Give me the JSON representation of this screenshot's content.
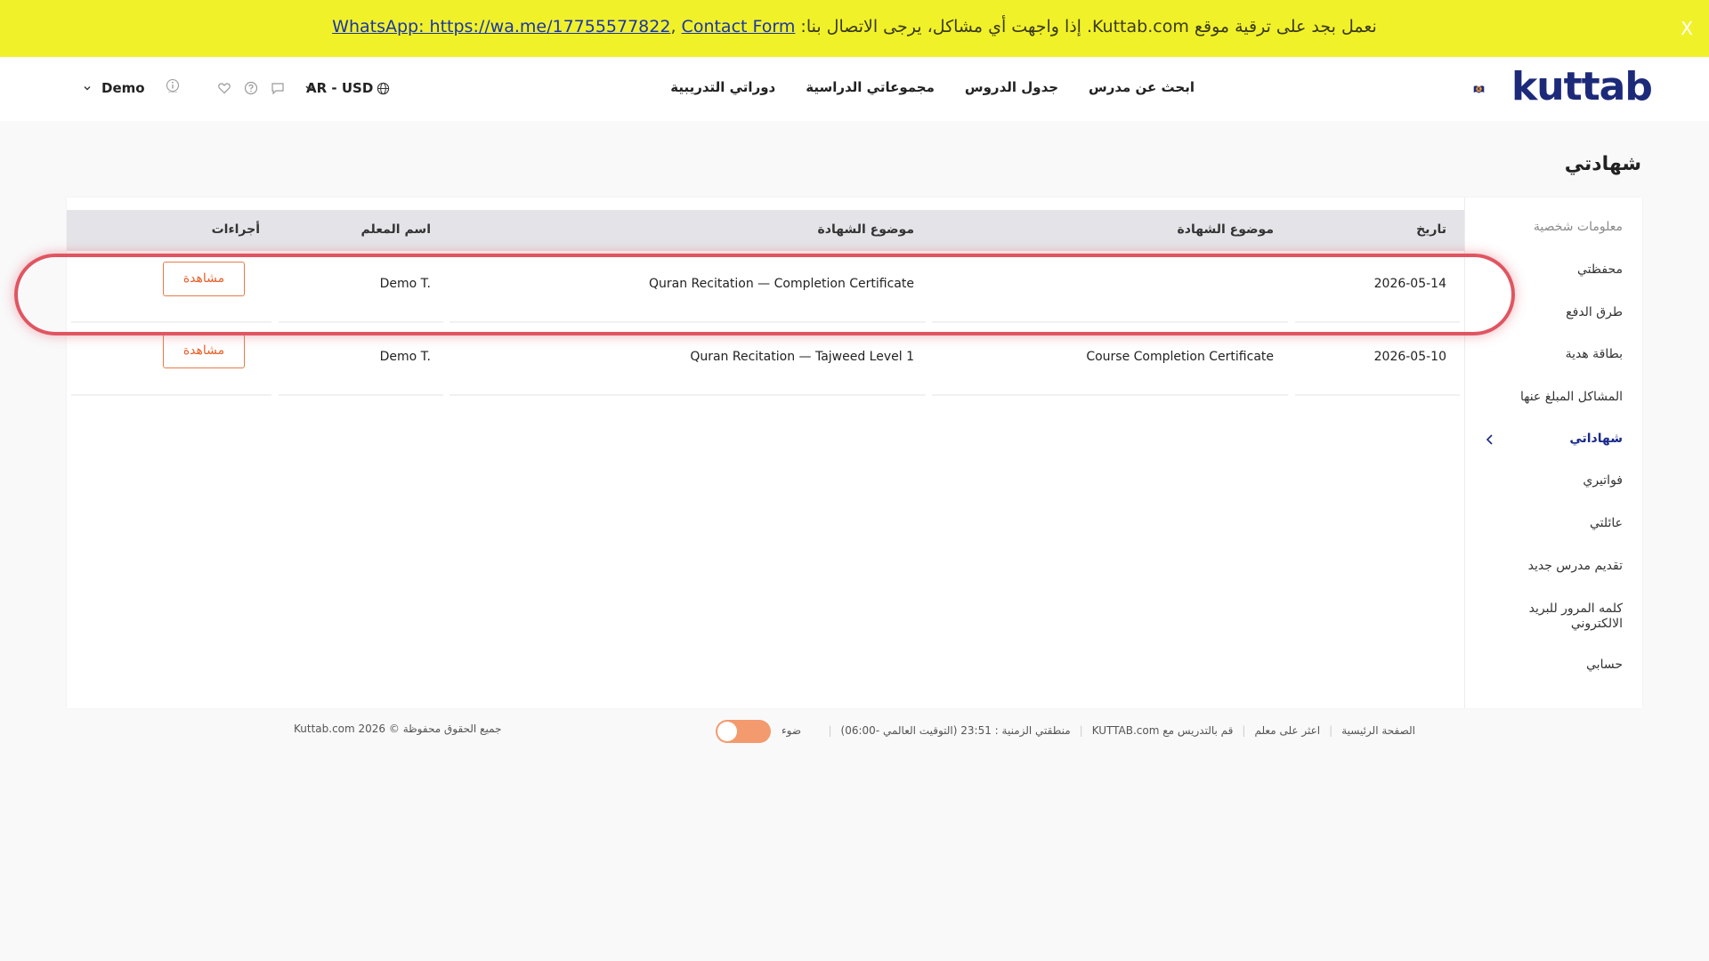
{
  "banner": {
    "text": "نعمل بجد على ترقية موقع Kuttab.com. إذا واجهت أي مشاكل، يرجى الاتصال بنا:",
    "link_whatsapp": "WhatsApp: https://wa.me/17755577822",
    "separator": ",",
    "link_contact": "Contact Form",
    "close": "X"
  },
  "header": {
    "logo": "kuttab",
    "logo_letter": "K",
    "nav": [
      "ابحث عن مدرس",
      "جدول الدروس",
      "مجموعاتي الدراسية",
      "دوراتي التدريبية"
    ],
    "currency": "AR - USD",
    "user_name": "Demo",
    "icons": [
      "globe-icon",
      "chevron-down-icon",
      "chat-icon",
      "help-icon",
      "heart-icon",
      "info-icon"
    ]
  },
  "page": {
    "title": "شهادتي"
  },
  "sidebar": {
    "items": [
      {
        "label": "معلومات شخصية",
        "state": "muted"
      },
      {
        "label": "محفظتي",
        "state": "normal"
      },
      {
        "label": "طرق الدفع",
        "state": "normal"
      },
      {
        "label": "بطاقة هدية",
        "state": "normal"
      },
      {
        "label": "المشاكل المبلغ عنها",
        "state": "normal"
      },
      {
        "label": "شهاداتي",
        "state": "active"
      },
      {
        "label": "فواتيري",
        "state": "normal"
      },
      {
        "label": "عائلتي",
        "state": "normal"
      },
      {
        "label": "تقديم مدرس جديد",
        "state": "normal"
      },
      {
        "label": "كلمه المرور للبريد الالكتروني",
        "state": "normal"
      },
      {
        "label": "حسابي",
        "state": "normal"
      }
    ]
  },
  "table": {
    "columns": [
      "تاريخ",
      "موضوع الشهادة",
      "موضوع الشهادة",
      "اسم المعلم",
      "أجراءات"
    ],
    "rows": [
      {
        "date": "2026-05-14",
        "type": "",
        "subject": "Quran Recitation — Completion Certificate",
        "teacher": "Demo T.",
        "action": "مشاهدة",
        "highlighted": true
      },
      {
        "date": "2026-05-10",
        "type": "Course Completion Certificate",
        "subject": "Quran Recitation — Tajweed Level 1",
        "teacher": "Demo T.",
        "action": "مشاهدة",
        "highlighted": false
      }
    ]
  },
  "footer": {
    "links": [
      "الصفحة الرئيسية",
      "اعثر على معلم",
      "قم بالتدريس مع KUTTAB.com"
    ],
    "timezone": "منطقتي الزمنية : 23:51 (التوقيت العالمي -06:00)",
    "theme_label": "ضوء",
    "copyright": "Kuttab.com 2026 © جميع الحقوق محفوظة"
  },
  "colors": {
    "banner_bg": "#f1f12a",
    "brand_navy": "#1d2a7a",
    "accent_orange": "#e8602a",
    "highlight_red": "#e05561"
  }
}
